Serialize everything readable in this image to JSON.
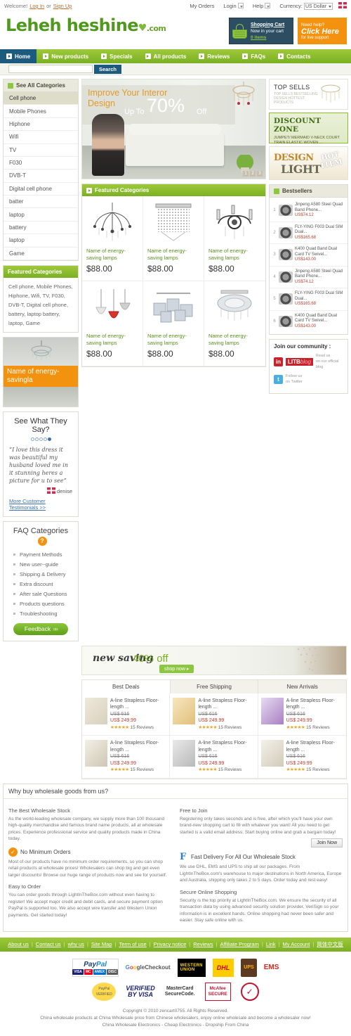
{
  "topbar": {
    "welcome": "Welcome!",
    "login": "Log In",
    "or": "or",
    "signup": "Sign Up",
    "my_orders": "My Orders",
    "login_menu": "Login",
    "help_menu": "Help",
    "currency_label": "Currency:",
    "currency_value": "US Dollar",
    "flag": "uk-flag-icon"
  },
  "header": {
    "logo_main": "Leheh heshine",
    "logo_heart": "♥",
    "logo_tld": ".com",
    "cart": {
      "title": "Shopping Cart",
      "subtitle": "Now in your cart",
      "items": "0 items"
    },
    "help": {
      "line1": "Need help?",
      "line2": "Click Here",
      "line3": "for live support"
    }
  },
  "nav": {
    "items": [
      {
        "label": "Home",
        "active": true
      },
      {
        "label": "New products",
        "active": false
      },
      {
        "label": "Specials",
        "active": false
      },
      {
        "label": "All products",
        "active": false
      },
      {
        "label": "Reviews",
        "active": false
      },
      {
        "label": "FAQs",
        "active": false
      },
      {
        "label": "Contacts",
        "active": false
      }
    ]
  },
  "search": {
    "value": "",
    "placeholder": "",
    "button": "Search"
  },
  "sidebar": {
    "categories_header": "See All Categories",
    "categories": [
      {
        "label": "Cell phone",
        "selected": true
      },
      {
        "label": "Mobile Phones",
        "selected": false
      },
      {
        "label": "Hiphone",
        "selected": false
      },
      {
        "label": "Wifi",
        "selected": false
      },
      {
        "label": "TV",
        "selected": false
      },
      {
        "label": "F030",
        "selected": false
      },
      {
        "label": "DVB-T",
        "selected": false
      },
      {
        "label": "Digital cell phone",
        "selected": false
      },
      {
        "label": "batter",
        "selected": false
      },
      {
        "label": "laptop",
        "selected": false
      },
      {
        "label": "battery",
        "selected": false
      },
      {
        "label": "laptop",
        "selected": false
      },
      {
        "label": "Game",
        "selected": false
      }
    ],
    "featured_header": "Featured Categories",
    "featured_text": "Cell phone, Mobile Phones, Hiphone, Wifi, TV, F030, DVB-T, Digital cell phone, battery, laptop battery, laptop, Game",
    "promo_label": "Name of energy-savingla",
    "testimonials": {
      "title": "See What They Say?",
      "quote": "“I love this dress it was beautiful my husband loved me in it stunning heres a picture for u to see”",
      "author": "denise",
      "more_link": "More Customer Testimonials >>"
    },
    "faq": {
      "title": "FAQ Categories",
      "badge": "?",
      "items": [
        "Payment Methods",
        "New user--guide",
        "Shipping & Delivery",
        "Extra discount",
        "After sale Questions",
        "Products questions",
        "Troubleshooting"
      ],
      "feedback_button": "Feedback"
    }
  },
  "hero": {
    "headline": "Improve Your Interor Design",
    "upto": "Up To",
    "percent": "70%",
    "off": "Off",
    "pager": [
      "1",
      "2",
      "3"
    ]
  },
  "featured": {
    "header": "Featured Categories",
    "products": [
      {
        "name": "Name of energy-saving lamps",
        "price": "$88.00",
        "icon": "chandelier-icon"
      },
      {
        "name": "Name of energy-saving lamps",
        "price": "$88.00",
        "icon": "crystal-drum-icon"
      },
      {
        "name": "Name of energy-saving lamps",
        "price": "$88.00",
        "icon": "candle-chandelier-icon"
      },
      {
        "name": "Name of energy-saving lamps",
        "price": "$88.00",
        "icon": "pendant-lamp-icon"
      },
      {
        "name": "Name of energy-saving lamps",
        "price": "$88.00",
        "icon": "square-ceiling-icon"
      },
      {
        "name": "Name of energy-saving lamps",
        "price": "$88.00",
        "icon": "flush-mount-icon"
      }
    ]
  },
  "sale_banner": {
    "script_text": "new saving",
    "percent_text": "40% off",
    "button": "shop now ▸"
  },
  "deals": {
    "tabs": [
      {
        "label": "Best Deals",
        "active": true
      },
      {
        "label": "Free Shipping",
        "active": false
      },
      {
        "label": "New Arrivals",
        "active": false
      }
    ],
    "items": [
      {
        "title": "A-line Strapless Floor-length ...",
        "old_price": "US$ 616",
        "new_price": "US$ 249.99",
        "reviews": "15 Reviews",
        "stars": "★★★★★"
      },
      {
        "title": "A-line Strapless Floor-length ...",
        "old_price": "US$ 616",
        "new_price": "US$ 249.99",
        "reviews": "15 Reviews",
        "stars": "★★★★★"
      },
      {
        "title": "A-line Strapless Floor-length ...",
        "old_price": "US$ 616",
        "new_price": "US$ 249.99",
        "reviews": "15 Reviews",
        "stars": "★★★★★"
      },
      {
        "title": "A-line Strapless Floor-length ...",
        "old_price": "US$ 616",
        "new_price": "US$ 249.99",
        "reviews": "15 Reviews",
        "stars": "★★★★★"
      },
      {
        "title": "A-line Strapless Floor-length ...",
        "old_price": "US$ 616",
        "new_price": "US$ 249.99",
        "reviews": "15 Reviews",
        "stars": "★★★★★"
      },
      {
        "title": "A-line Strapless Floor-length ...",
        "old_price": "US$ 616",
        "new_price": "US$ 249.99",
        "reviews": "15 Reviews",
        "stars": "★★★★★"
      }
    ]
  },
  "right": {
    "topsells": {
      "title": "TOP SELLS",
      "text": "TOP SELLS BESTSELLING DESIGN HOTTEST PRODUCTS"
    },
    "discount_zone": {
      "title": "DISCOUNT ZONE",
      "text": "JUMPET/ MERMAID V-NECK COURT TRAIN ELASTIC WOVEN ..."
    },
    "design_light": {
      "line1": "DESIGN",
      "line2": "LIGHT",
      "badge_line1": "HOT",
      "badge_line2": "ITEM"
    },
    "bestsellers_header": "Bestsellers",
    "bestsellers": [
      {
        "rank": "1",
        "title": "Jinpeng A580 Steel Quad Band Phone...",
        "price": "US$74.12"
      },
      {
        "rank": "2",
        "title": "FLY-YING F003 Dual SIM Dual...",
        "price": "US$165.68"
      },
      {
        "rank": "3",
        "title": "K400 Quad Band Dual Card TV Swivel...",
        "price": "US$143.00"
      },
      {
        "rank": "4",
        "title": "Jinpeng A580 Steel Quad Band Phone...",
        "price": "US$74.12"
      },
      {
        "rank": "5",
        "title": "FLY-YING F003 Dual SIM Dual...",
        "price": "US$165.68"
      },
      {
        "rank": "6",
        "title": "K400 Quad Band Dual Card TV Swivel...",
        "price": "US$143.00"
      }
    ],
    "community": {
      "title": "Join our community :",
      "blog_brand": "LITB",
      "blog_brand_suffix": "blog",
      "blog_line1": "Read us",
      "blog_line2": "on our official blog",
      "twitter_line1": "Follow us",
      "twitter_line2": "on Twitter"
    }
  },
  "why": {
    "header": "Why buy wholesale goods from us?",
    "left": [
      {
        "title": "The Best Wholesale Stock",
        "icon": "",
        "body": "As the world-leading wholesale company, we supply more than 100 thousand high-quality merchandise and famous brand name products, all at wholesale prices. Experience professional service and quality products made in China today."
      },
      {
        "title": "No Minimum Orders",
        "icon": "check-circle-icon",
        "body": "Most of our products have no minimum order requirements, so you can shop retail products at wholesale prices! Wholesalers can shop big and get even larger discounts! Browse our huge range of products now and see for yourself."
      },
      {
        "title": "Easy to Order",
        "icon": "",
        "body": "You can order goods through LightInTheBox.com without even having to register! We accept major credit and debit cards, and secure payment option PayPal is supported too. We also accept wire transfer and Western Union payments. Get started today!"
      }
    ],
    "right": [
      {
        "title": "Free to Join",
        "icon": "",
        "body": "Registering only takes seconds and is free, after which you'll have your own brand-new shopping cart to fill with whatever you want! All you need to get started is a valid email address. Start buying online and grab a bargain today!",
        "button": "Join Now"
      },
      {
        "title": "Fast Delivery For All Our Wholesale Stock",
        "icon": "fedex-f-icon",
        "body": "We use DHL, EMS and UPS to ship all our packages. From LightInTheBox.com's warehouse to major destinations in North America, Europe and Australia, shipping only takes 2 to 5 days. Order today and rest easy!"
      },
      {
        "title": "Secure Online Shopping",
        "icon": "",
        "body": "Security is the top priority at LightInTheBox.com. We ensure the security of all transaction data by using advanced security solution provider, VeriSign so your information is in excellent hands. Online shopping had never been safer and easier. Stay safe online with us."
      }
    ]
  },
  "footer": {
    "links": [
      "About us",
      "Contact us",
      "why us",
      "Site Map",
      "Term of use",
      "Privacy notice",
      "Reviews",
      "Affiliate Program",
      "Link",
      "My Account",
      "简体中文版"
    ],
    "payments": [
      {
        "name": "paypal-logo",
        "label": "PayPal"
      },
      {
        "name": "google-checkout-logo",
        "label": "Checkout"
      },
      {
        "name": "western-union-logo",
        "label": "WESTERN UNION"
      },
      {
        "name": "dhl-logo",
        "label": "DHL"
      },
      {
        "name": "ups-logo",
        "label": "UPS"
      },
      {
        "name": "ems-logo",
        "label": "EMS"
      }
    ],
    "trust": [
      {
        "name": "paypal-verified-seal",
        "label": "PayPal VERIFIED"
      },
      {
        "name": "verified-by-visa-seal",
        "label": "VERIFIED BY VISA"
      },
      {
        "name": "mastercard-securecode-seal",
        "label": "MasterCard SecureCode."
      },
      {
        "name": "mcafee-secure-seal",
        "label": "McAfee SECURE"
      },
      {
        "name": "verisign-seal",
        "label": "VeriSign Trusted"
      }
    ],
    "copyright": "Copyright © 2010 zencart0755. All Rights Reserved.",
    "line2": "China wholesale products at China Wholesale price from Chinese wholesalers, enjoy online wholesale and become a wholesaler now!",
    "line3": "China Wholesale Electronics - Cheap Electronics - Dropship From China"
  }
}
